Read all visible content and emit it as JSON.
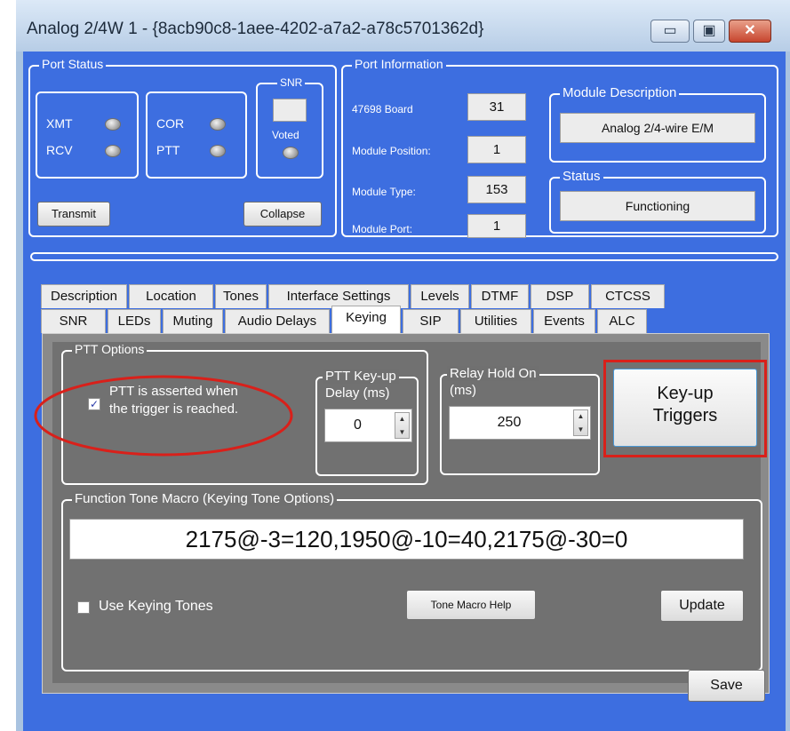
{
  "window": {
    "title": "Analog 2/4W 1   - {8acb90c8-1aee-4202-a7a2-a78c5701362d}",
    "buttons": [
      {
        "name": "minimize-button",
        "glyph": "▭"
      },
      {
        "name": "maximize-button",
        "glyph": "▣"
      },
      {
        "name": "close-button",
        "glyph": "✕"
      }
    ]
  },
  "port_status": {
    "label": "Port Status",
    "xmt": "XMT",
    "rcv": "RCV",
    "cor": "COR",
    "ptt": "PTT",
    "snr_label": "SNR",
    "voted": "Voted",
    "transmit_button": "Transmit",
    "collapse_button": "Collapse"
  },
  "port_info": {
    "label": "Port Information",
    "rows": [
      {
        "label": "47698 Board",
        "value": "31"
      },
      {
        "label": "Module Position:",
        "value": "1"
      },
      {
        "label": "Module Type:",
        "value": "153"
      },
      {
        "label": "Module Port:",
        "value": "1"
      }
    ],
    "module_description_label": "Module Description",
    "module_description": "Analog 2/4-wire E/M",
    "status_label": "Status",
    "status": "Functioning"
  },
  "tabs": {
    "row1": [
      "Description",
      "Location",
      "Tones",
      "Interface Settings",
      "Levels",
      "DTMF",
      "DSP",
      "CTCSS"
    ],
    "row2": [
      "SNR",
      "LEDs",
      "Muting",
      "Audio Delays",
      "Keying",
      "SIP",
      "Utilities",
      "Events",
      "ALC"
    ],
    "active": "Keying"
  },
  "keying": {
    "ptt_options_label": "PTT Options",
    "ptt_asserted_line1": "PTT is asserted when",
    "ptt_asserted_line2": "the trigger is reached.",
    "ptt_asserted_checked": true,
    "ptt_keyup_label_line1": "PTT Key-up",
    "ptt_keyup_label_line2": "Delay (ms)",
    "ptt_keyup_value": "0",
    "relay_hold_label_line1": "Relay Hold On",
    "relay_hold_label_line2": "(ms)",
    "relay_hold_value": "250",
    "keyup_triggers_line1": "Key-up",
    "keyup_triggers_line2": "Triggers",
    "function_tone_label": "Function Tone Macro (Keying Tone Options)",
    "macro_value": "2175@-3=120,1950@-10=40,2175@-30=0",
    "use_keying_tones": "Use Keying Tones",
    "use_keying_tones_checked": false,
    "tone_macro_help": "Tone Macro Help",
    "update": "Update"
  },
  "save_button": "Save",
  "annotation_color": "#d9201a"
}
